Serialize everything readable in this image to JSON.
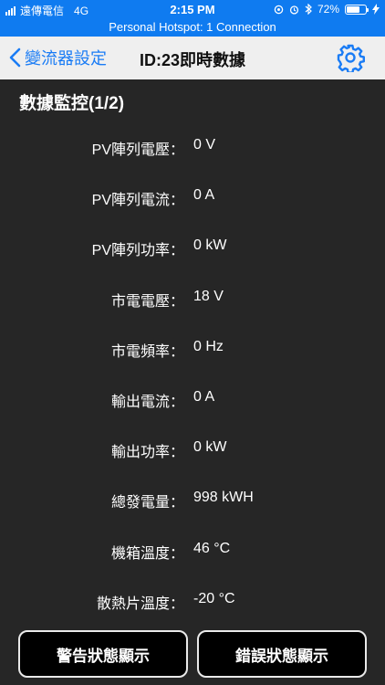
{
  "status_bar": {
    "carrier": "遠傳電信",
    "network": "4G",
    "time": "2:15 PM",
    "battery_percent": "72%",
    "battery_level": 0.72
  },
  "hotspot_banner": "Personal Hotspot: 1 Connection",
  "nav": {
    "back_label": "變流器設定",
    "title": "ID:23即時數據",
    "icon": "gear-icon",
    "accent": "#1a7cf5"
  },
  "section_title": "數據監控(1/2)",
  "metrics": [
    {
      "label": "PV陣列電壓：",
      "value": "0 V"
    },
    {
      "label": "PV陣列電流：",
      "value": "0 A"
    },
    {
      "label": "PV陣列功率：",
      "value": "0 kW"
    },
    {
      "label": "市電電壓：",
      "value": "18 V"
    },
    {
      "label": "市電頻率：",
      "value": "0 Hz"
    },
    {
      "label": "輸出電流：",
      "value": "0 A"
    },
    {
      "label": "輸出功率：",
      "value": "0 kW"
    },
    {
      "label": "總發電量：",
      "value": "998 kWH"
    },
    {
      "label": "機箱溫度：",
      "value": "46 °C"
    },
    {
      "label": "散熱片溫度：",
      "value": "-20 °C"
    }
  ],
  "buttons": {
    "warning_status": "警告狀態顯示",
    "error_status": "錯誤狀態顯示"
  }
}
